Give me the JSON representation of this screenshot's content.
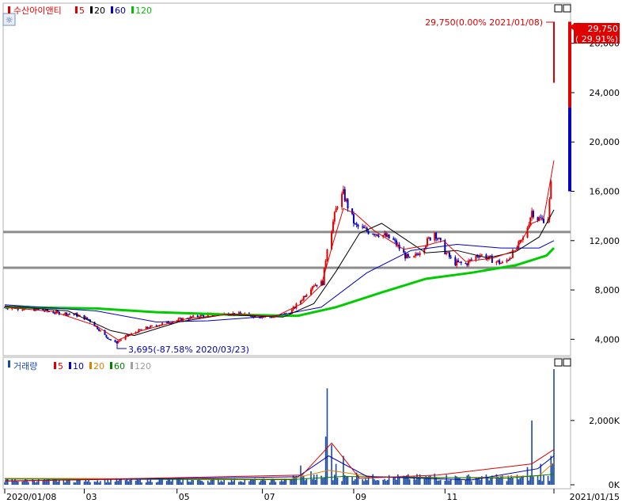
{
  "price_panel": {
    "title": "수산아이앤티",
    "ma_legend": [
      {
        "label": "5",
        "color": "#e00000"
      },
      {
        "label": "20",
        "color": "#000000"
      },
      {
        "label": "60",
        "color": "#0000c0"
      },
      {
        "label": "120",
        "color": "#00c000"
      }
    ],
    "high_annotation": "29,750(0.00% 2021/01/08)",
    "low_annotation": "3,695(-87.58% 2020/03/23)",
    "current_price": "29,750",
    "current_change": "( 29.91%)"
  },
  "volume_panel": {
    "title": "거래량",
    "ma_legend": [
      {
        "label": "5",
        "color": "#e00000"
      },
      {
        "label": "10",
        "color": "#0000c0"
      },
      {
        "label": "20",
        "color": "#e08000"
      },
      {
        "label": "60",
        "color": "#008000"
      },
      {
        "label": "120",
        "color": "#a0a0a0"
      }
    ]
  },
  "colors": {
    "up": "#e00000",
    "down": "#0000c0",
    "ma5": "#e00000",
    "ma20": "#000000",
    "ma60": "#0000c0",
    "ma120": "#00cc00",
    "hline": "#8c8c8c",
    "volume_bar": "#1a4aa0"
  },
  "chart_data": [
    {
      "type": "candlestick",
      "title": "수산아이앤티",
      "ylim": [
        2800,
        31000
      ],
      "y_ticks": [
        "4,000",
        "8,000",
        "12,000",
        "16,000",
        "20,000",
        "24,000",
        "28,000"
      ],
      "y_tick_values": [
        4000,
        8000,
        12000,
        16000,
        20000,
        24000,
        28000
      ],
      "x_tick_labels": [
        "2020/01/08",
        "03",
        "05",
        "07",
        "09",
        "11",
        "2021/01/15"
      ],
      "x_tick_dates": [
        "2020-01-08",
        "2020-03-02",
        "2020-05-04",
        "2020-07-01",
        "2020-09-01",
        "2020-11-02",
        "2021-01-15"
      ],
      "x_range": [
        "2020-01-08",
        "2021-01-15"
      ],
      "horizontal_lines": [
        12700,
        9800
      ],
      "price_path": [
        [
          "2020-01-08",
          6600
        ],
        [
          "2020-01-25",
          6500
        ],
        [
          "2020-02-10",
          6200
        ],
        [
          "2020-02-25",
          6000
        ],
        [
          "2020-03-05",
          5600
        ],
        [
          "2020-03-12",
          4800
        ],
        [
          "2020-03-17",
          4200
        ],
        [
          "2020-03-23",
          3700
        ],
        [
          "2020-03-30",
          4200
        ],
        [
          "2020-04-10",
          4800
        ],
        [
          "2020-04-25",
          5300
        ],
        [
          "2020-05-10",
          5700
        ],
        [
          "2020-05-25",
          6000
        ],
        [
          "2020-06-10",
          6100
        ],
        [
          "2020-06-25",
          5900
        ],
        [
          "2020-07-10",
          5800
        ],
        [
          "2020-07-20",
          6200
        ],
        [
          "2020-07-28",
          7300
        ],
        [
          "2020-08-04",
          8400
        ],
        [
          "2020-08-11",
          8600
        ],
        [
          "2020-08-14",
          11500
        ],
        [
          "2020-08-18",
          13500
        ],
        [
          "2020-08-21",
          15000
        ],
        [
          "2020-08-25",
          15800
        ],
        [
          "2020-08-28",
          14800
        ],
        [
          "2020-09-02",
          13200
        ],
        [
          "2020-09-10",
          12800
        ],
        [
          "2020-09-20",
          12500
        ],
        [
          "2020-09-28",
          12000
        ],
        [
          "2020-10-05",
          10900
        ],
        [
          "2020-10-10",
          10300
        ],
        [
          "2020-10-18",
          11500
        ],
        [
          "2020-10-26",
          12700
        ],
        [
          "2020-11-01",
          11300
        ],
        [
          "2020-11-08",
          10200
        ],
        [
          "2020-11-16",
          10100
        ],
        [
          "2020-11-25",
          10900
        ],
        [
          "2020-12-05",
          10400
        ],
        [
          "2020-12-12",
          10100
        ],
        [
          "2020-12-20",
          11300
        ],
        [
          "2020-12-26",
          12300
        ],
        [
          "2020-12-31",
          14400
        ],
        [
          "2021-01-04",
          13800
        ],
        [
          "2021-01-07",
          13700
        ],
        [
          "2021-01-11",
          13900
        ],
        [
          "2021-01-13",
          16500
        ],
        [
          "2021-01-14",
          19000
        ],
        [
          "2021-01-15",
          29750
        ]
      ],
      "ma5": [
        [
          "2020-01-08",
          6600
        ],
        [
          "2020-02-10",
          6250
        ],
        [
          "2020-03-10",
          5100
        ],
        [
          "2020-03-25",
          3950
        ],
        [
          "2020-04-10",
          4700
        ],
        [
          "2020-05-10",
          5650
        ],
        [
          "2020-06-10",
          6050
        ],
        [
          "2020-07-10",
          5850
        ],
        [
          "2020-07-28",
          6900
        ],
        [
          "2020-08-10",
          8400
        ],
        [
          "2020-08-18",
          11800
        ],
        [
          "2020-08-25",
          14600
        ],
        [
          "2020-09-02",
          14200
        ],
        [
          "2020-09-15",
          12800
        ],
        [
          "2020-10-05",
          11300
        ],
        [
          "2020-10-20",
          11600
        ],
        [
          "2020-11-01",
          12000
        ],
        [
          "2020-11-16",
          10300
        ],
        [
          "2020-12-05",
          10600
        ],
        [
          "2020-12-20",
          11200
        ],
        [
          "2020-12-31",
          13400
        ],
        [
          "2021-01-08",
          13800
        ],
        [
          "2021-01-15",
          18500
        ]
      ],
      "ma20": [
        [
          "2020-01-08",
          6700
        ],
        [
          "2020-02-20",
          6300
        ],
        [
          "2020-03-20",
          4700
        ],
        [
          "2020-04-05",
          4300
        ],
        [
          "2020-05-05",
          5400
        ],
        [
          "2020-06-05",
          6000
        ],
        [
          "2020-07-15",
          5800
        ],
        [
          "2020-08-05",
          6900
        ],
        [
          "2020-08-20",
          9500
        ],
        [
          "2020-09-05",
          12600
        ],
        [
          "2020-09-20",
          13400
        ],
        [
          "2020-10-05",
          12200
        ],
        [
          "2020-10-20",
          11000
        ],
        [
          "2020-11-10",
          11200
        ],
        [
          "2020-12-01",
          10600
        ],
        [
          "2020-12-20",
          11100
        ],
        [
          "2021-01-05",
          12300
        ],
        [
          "2021-01-15",
          14500
        ]
      ],
      "ma60": [
        [
          "2020-01-08",
          6800
        ],
        [
          "2020-03-10",
          6300
        ],
        [
          "2020-04-20",
          5400
        ],
        [
          "2020-05-25",
          5500
        ],
        [
          "2020-07-10",
          5900
        ],
        [
          "2020-08-10",
          6600
        ],
        [
          "2020-09-10",
          9400
        ],
        [
          "2020-10-10",
          11200
        ],
        [
          "2020-11-10",
          11700
        ],
        [
          "2020-12-10",
          11400
        ],
        [
          "2021-01-05",
          11400
        ],
        [
          "2021-01-15",
          12000
        ]
      ],
      "ma120": [
        [
          "2020-01-08",
          6600
        ],
        [
          "2020-03-10",
          6500
        ],
        [
          "2020-04-20",
          6200
        ],
        [
          "2020-06-10",
          6000
        ],
        [
          "2020-07-25",
          5900
        ],
        [
          "2020-08-20",
          6600
        ],
        [
          "2020-09-20",
          7800
        ],
        [
          "2020-10-20",
          8900
        ],
        [
          "2020-11-20",
          9400
        ],
        [
          "2020-12-20",
          10000
        ],
        [
          "2021-01-10",
          10800
        ],
        [
          "2021-01-15",
          11400
        ]
      ]
    },
    {
      "type": "bar",
      "title": "거래량",
      "ylim": [
        0,
        3500
      ],
      "y_unit": "K",
      "y_ticks": [
        "0K",
        "2,000K"
      ],
      "y_tick_values": [
        0,
        2000
      ],
      "x_range": [
        "2020-01-08",
        "2021-01-15"
      ],
      "spikes": [
        [
          "2020-07-27",
          600
        ],
        [
          "2020-08-03",
          420
        ],
        [
          "2020-08-13",
          1500
        ],
        [
          "2020-08-14",
          3000
        ],
        [
          "2020-08-17",
          1250
        ],
        [
          "2020-08-20",
          650
        ],
        [
          "2020-08-25",
          900
        ],
        [
          "2020-09-03",
          380
        ],
        [
          "2020-10-26",
          350
        ],
        [
          "2020-12-28",
          550
        ],
        [
          "2020-12-31",
          2000
        ],
        [
          "2021-01-06",
          650
        ],
        [
          "2021-01-13",
          900
        ],
        [
          "2021-01-14",
          650
        ],
        [
          "2021-01-15",
          3600
        ]
      ],
      "baseline_volume": 140
    }
  ]
}
